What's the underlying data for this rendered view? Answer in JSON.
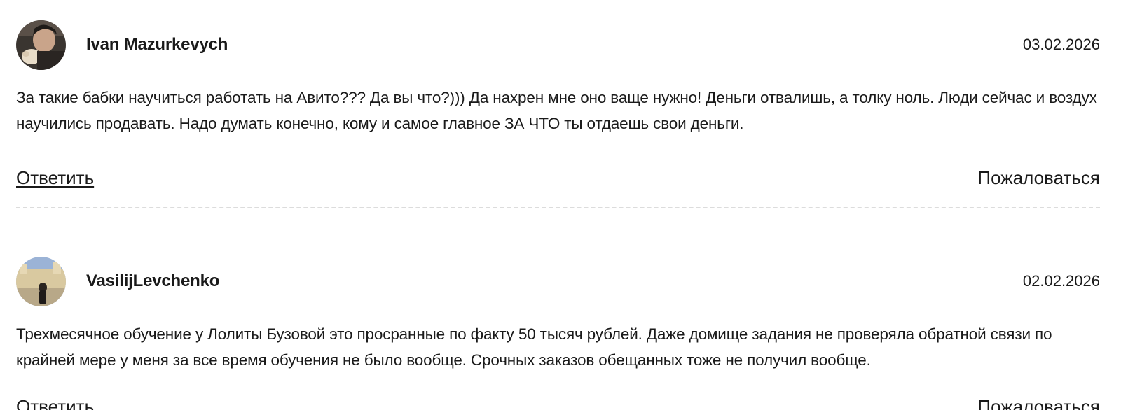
{
  "reviews": [
    {
      "author": "Ivan Mazurkevych",
      "date": "03.02.2026",
      "text": "За такие бабки научиться работать на Авито??? Да вы что?))) Да нахрен мне оно ваще нужно! Деньги отвалишь, а толку ноль. Люди сейчас и воздух научились продавать. Надо думать конечно, кому и самое главное ЗА ЧТО ты отдаешь свои деньги.",
      "reply_label": "Ответить",
      "report_label": "Пожаловаться"
    },
    {
      "author": "VasilijLevchenko",
      "date": "02.02.2026",
      "text": "Трехмесячное обучение у Лолиты Бузовой это просранные по факту 50 тысяч рублей. Даже домище задания не проверяла обратной связи по крайней мере у меня за все время обучения не было вообще. Срочных заказов обещанных тоже не получил вообще.",
      "reply_label": "Ответить",
      "report_label": "Пожаловаться"
    }
  ],
  "colors": {
    "text": "#1a1a1a",
    "divider": "#dcdcdc",
    "background": "#ffffff"
  }
}
